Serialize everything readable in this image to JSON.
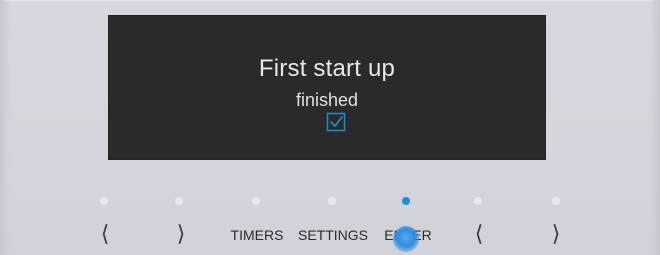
{
  "display": {
    "title": "First start up",
    "subtitle": "finished",
    "status_icon": "checkbox-checked-icon",
    "accent_color": "#1e8fd2"
  },
  "controls": {
    "left_arrow_1": "⟨",
    "right_arrow_1": "⟩",
    "timers_label": "TIMERS",
    "settings_label": "SETTINGS",
    "enter_label": "ENTER",
    "left_arrow_2": "⟨",
    "right_arrow_2": "⟩",
    "active_indicator": "enter"
  }
}
